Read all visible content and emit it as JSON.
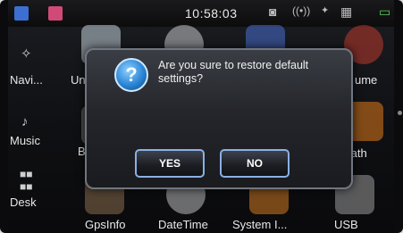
{
  "status": {
    "time": "10:58:03"
  },
  "sidebar": {
    "items": [
      {
        "label": "Navi...",
        "icon": "compass-icon"
      },
      {
        "label": "Music",
        "icon": "music-note-icon"
      },
      {
        "label": "Desk",
        "icon": "grid-icon"
      }
    ]
  },
  "apps": {
    "row1_partial": [
      "Un",
      "ume"
    ],
    "row2_partial": [
      "B",
      "Path"
    ],
    "bottom": [
      "GpsInfo",
      "DateTime",
      "System I...",
      "USB"
    ]
  },
  "dialog": {
    "message": "Are you sure to restore default settings?",
    "yes_label": "YES",
    "no_label": "NO",
    "icon": "question-icon"
  }
}
